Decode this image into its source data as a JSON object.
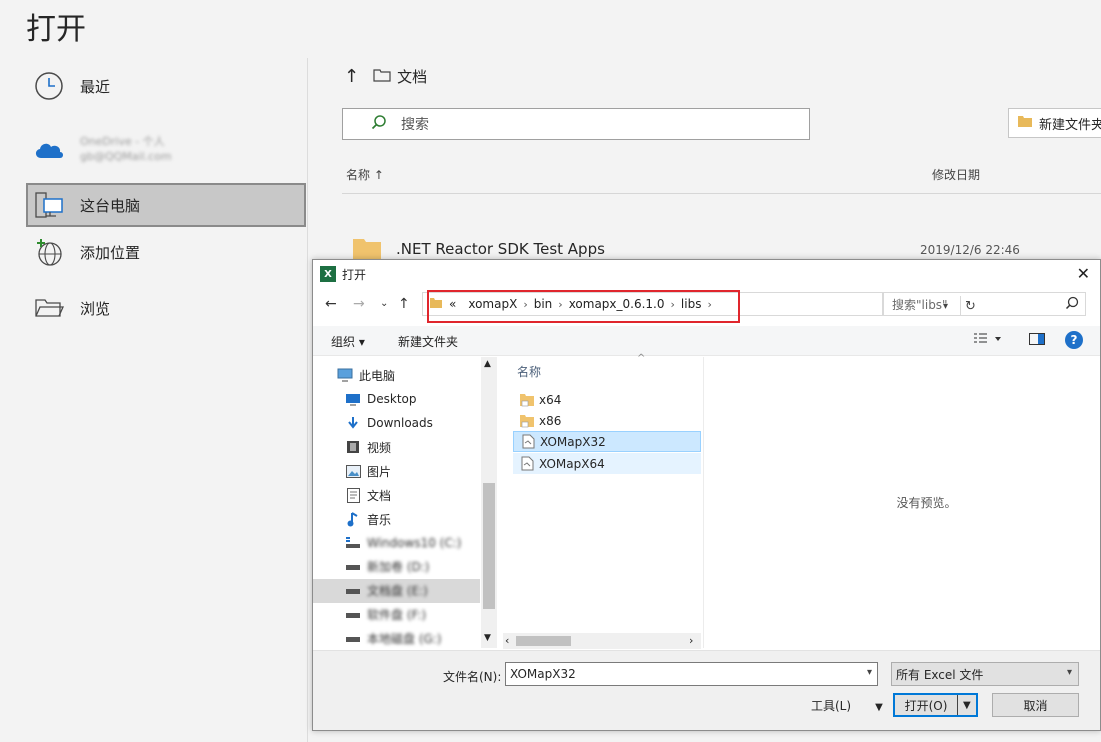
{
  "backstage": {
    "title": "打开",
    "nav": {
      "recent": "最近",
      "onedrive_line1": "OneDrive - 个人",
      "onedrive_line2": "gb@QQMail.com",
      "this_pc": "这台电脑",
      "add_place": "添加位置",
      "browse": "浏览"
    },
    "path_label": "文档",
    "search_placeholder": "搜索",
    "new_folder": "新建文件夹",
    "columns": {
      "name": "名称 ↑",
      "date": "修改日期"
    },
    "rows": [
      {
        "name": ".NET Reactor SDK Test Apps",
        "date": "2019/12/6 22:46"
      }
    ]
  },
  "dialog": {
    "title": "打开",
    "address": {
      "prefix": "«",
      "segments": [
        "xomapX",
        "bin",
        "xomapx_0.6.1.0",
        "libs"
      ]
    },
    "search_placeholder": "搜索\"libs\"",
    "toolbar": {
      "organize": "组织 ▾",
      "new_folder": "新建文件夹"
    },
    "tree": [
      {
        "label": "此电脑",
        "icon": "pc-icon"
      },
      {
        "label": "Desktop",
        "icon": "desktop-icon"
      },
      {
        "label": "Downloads",
        "icon": "downloads-icon"
      },
      {
        "label": "视频",
        "icon": "video-icon"
      },
      {
        "label": "图片",
        "icon": "pictures-icon"
      },
      {
        "label": "文档",
        "icon": "documents-icon"
      },
      {
        "label": "音乐",
        "icon": "music-icon"
      },
      {
        "label": "Windows10 (C:)",
        "icon": "drive-icon"
      },
      {
        "label": "新加卷 (D:)",
        "icon": "drive-icon"
      },
      {
        "label": "文档盘 (E:)",
        "icon": "drive-icon"
      },
      {
        "label": "软件盘 (F:)",
        "icon": "drive-icon"
      },
      {
        "label": "本地磁盘 (G:)",
        "icon": "drive-icon"
      }
    ],
    "list_header": "名称",
    "files": [
      {
        "name": "x64",
        "icon": "folder-icon"
      },
      {
        "name": "x86",
        "icon": "folder-icon"
      },
      {
        "name": "XOMapX32",
        "icon": "file-icon"
      },
      {
        "name": "XOMapX64",
        "icon": "file-icon"
      }
    ],
    "preview_text": "没有预览。",
    "filename_label": "文件名(N):",
    "filename_value": "XOMapX32",
    "filetype": "所有 Excel 文件",
    "tools": "工具(L)",
    "open_button": "打开(O)",
    "cancel_button": "取消"
  }
}
